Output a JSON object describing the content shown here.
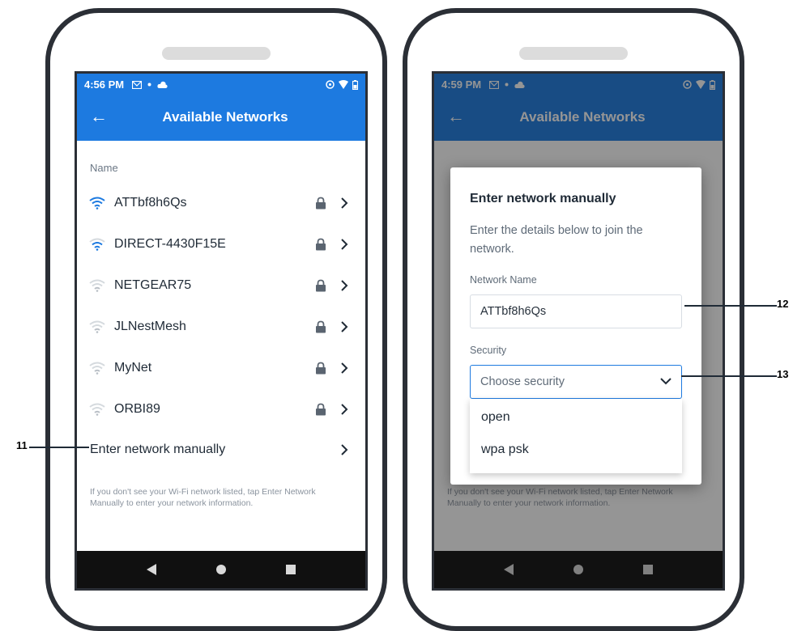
{
  "left_screen": {
    "status": {
      "time": "4:56 PM"
    },
    "appbar": {
      "title": "Available Networks"
    },
    "list_header": "Name",
    "networks": [
      {
        "name": "ATTbf8h6Qs",
        "strength": "strong",
        "color": "#1d7ae0"
      },
      {
        "name": "DIRECT-4430F15E",
        "strength": "medium",
        "color": "#1d7ae0"
      },
      {
        "name": "NETGEAR75",
        "strength": "weak",
        "color": "#b9bfc6"
      },
      {
        "name": "JLNestMesh",
        "strength": "weak",
        "color": "#b9bfc6"
      },
      {
        "name": "MyNet",
        "strength": "weak",
        "color": "#b9bfc6"
      },
      {
        "name": "ORBI89",
        "strength": "weak",
        "color": "#b9bfc6"
      }
    ],
    "manual_entry": "Enter network manually",
    "help_text": "If you don't see your Wi-Fi network listed, tap Enter Network Manually to enter your network information."
  },
  "right_screen": {
    "status": {
      "time": "4:59 PM"
    },
    "appbar": {
      "title": "Available Networks"
    },
    "dialog": {
      "title": "Enter network manually",
      "description": "Enter the details below to join the network.",
      "network_name_label": "Network Name",
      "network_name_value": "ATTbf8h6Qs",
      "security_label": "Security",
      "security_placeholder": "Choose security",
      "security_options": [
        "open",
        "wpa psk"
      ]
    }
  },
  "callouts": [
    "11",
    "12",
    "13"
  ],
  "colors": {
    "accent": "#1d7ae0",
    "frame": "#2b2f36",
    "navbar": "#101010"
  }
}
